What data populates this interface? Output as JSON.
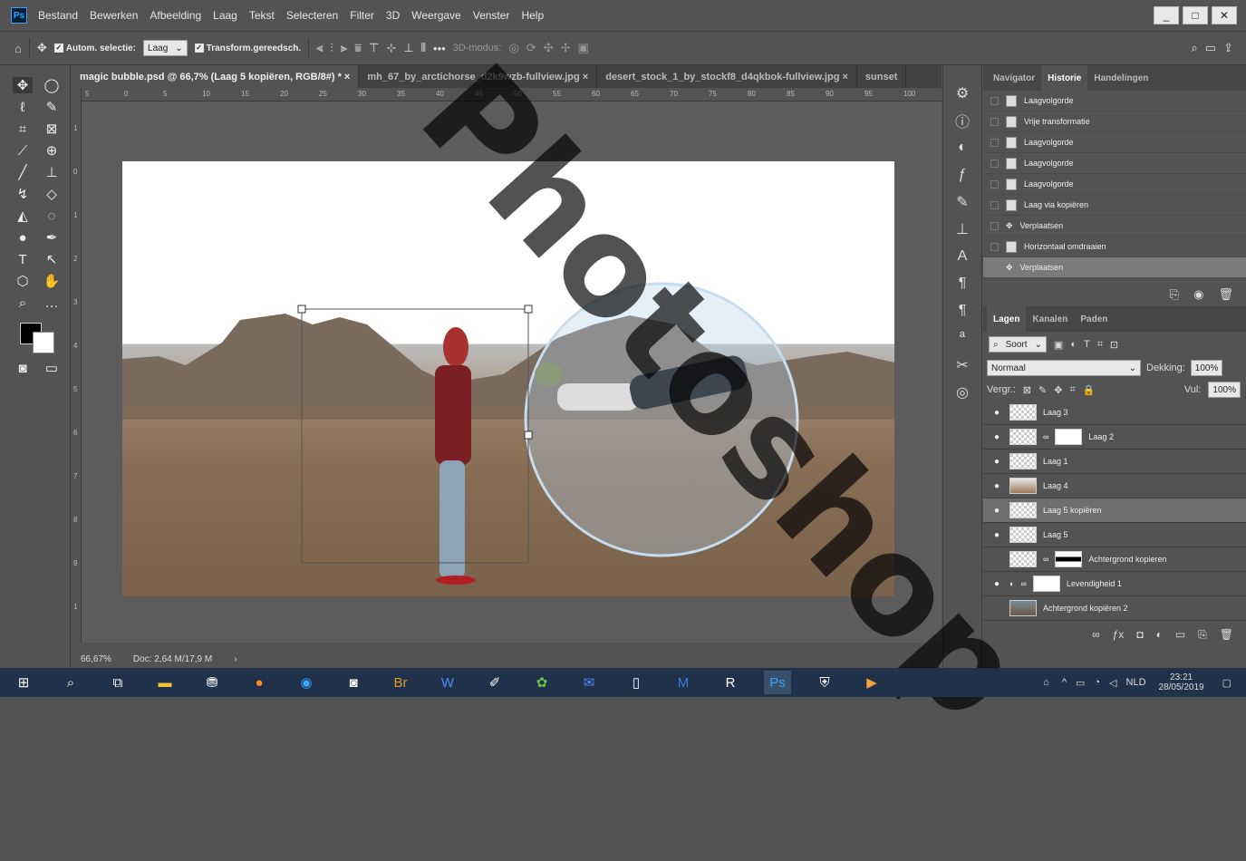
{
  "menubar": {
    "logo": "Ps",
    "items": [
      "Bestand",
      "Bewerken",
      "Afbeelding",
      "Laag",
      "Tekst",
      "Selecteren",
      "Filter",
      "3D",
      "Weergave",
      "Venster",
      "Help"
    ],
    "win_min": "_",
    "win_restore": "□",
    "win_close": "✕"
  },
  "options": {
    "autosel_label": "Autom. selectie:",
    "autosel_value": "Laag",
    "transform_label": "Transform.gereedsch.",
    "more": "•••",
    "mode3d": "3D-modus:"
  },
  "tabs": [
    "magic bubble.psd @ 66,7% (Laag 5 kopiëren, RGB/8#) *",
    "mh_67_by_arctichorse_d2k9wzb-fullview.jpg",
    "desert_stock_1_by_stockf8_d4qkbok-fullview.jpg",
    "sunset"
  ],
  "tab_close": "×",
  "ruler_h": [
    "5",
    "0",
    "5",
    "10",
    "15",
    "20",
    "25",
    "30",
    "35",
    "40",
    "45",
    "50",
    "55",
    "60",
    "65",
    "70",
    "75",
    "80",
    "85",
    "90",
    "95",
    "100"
  ],
  "ruler_v": [
    "1",
    "0",
    "1",
    "2",
    "3",
    "4",
    "5",
    "6",
    "7",
    "8",
    "9",
    "1"
  ],
  "status": {
    "zoom": "66,67%",
    "doc": "Doc: 2,64 M/17,9 M",
    "arrow": "›"
  },
  "history": {
    "tabs": [
      "Navigator",
      "Historie",
      "Handelingen"
    ],
    "items": [
      "Laagvolgorde",
      "Vrije transformatie",
      "Laagvolgorde",
      "Laagvolgorde",
      "Laagvolgorde",
      "Laag via kopiëren",
      "Verplaatsen",
      "Horizontaal omdraaien",
      "Verplaatsen"
    ],
    "selected": 8
  },
  "layers": {
    "tabs": [
      "Lagen",
      "Kanalen",
      "Paden"
    ],
    "filter": "Soort",
    "blend": "Normaal",
    "opacity_label": "Dekking:",
    "opacity": "100%",
    "lock_label": "Vergr.:",
    "fill_label": "Vul:",
    "fill": "100%",
    "items": [
      {
        "name": "Laag 3",
        "eye": "●"
      },
      {
        "name": "Laag 2",
        "eye": "●"
      },
      {
        "name": "Laag 1",
        "eye": "●"
      },
      {
        "name": "Laag 4",
        "eye": "●"
      },
      {
        "name": "Laag 5 kopiëren",
        "eye": "●"
      },
      {
        "name": "Laag 5",
        "eye": "●"
      },
      {
        "name": "Achtergrond kopieren",
        "eye": ""
      },
      {
        "name": "Levendigheid 1",
        "eye": "●"
      },
      {
        "name": "Achtergrond kopiëren 2",
        "eye": ""
      }
    ],
    "selected": 4
  },
  "taskbar": {
    "lang": "NLD",
    "time": "23:21",
    "date": "28/05/2019"
  },
  "colors": {
    "accent": "#31a8ff",
    "panel": "#535353",
    "taskbar": "#203249"
  }
}
